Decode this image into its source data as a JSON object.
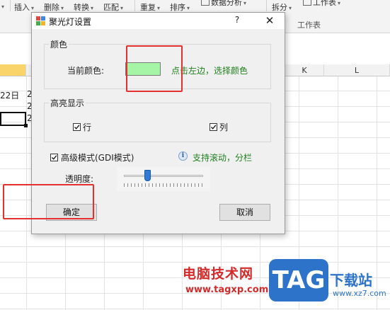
{
  "ribbon": {
    "items": [
      "插入",
      "删除",
      "转换",
      "匹配",
      "重复",
      "排序",
      "数据分析",
      "拆分",
      "工作表"
    ],
    "group_label": "工作表"
  },
  "sheet": {
    "col_k": "K",
    "col_l": "L",
    "cell_date": "22日",
    "cell_partial_1": "2",
    "cell_partial_2": "2",
    "cell_partial_3": "2"
  },
  "dialog": {
    "title": "聚光灯设置",
    "help": "?",
    "close": "✕",
    "color_group": {
      "title": "颜色",
      "current_color_label": "当前颜色:",
      "current_color": "#a6f5a6",
      "hint": "点击左边，选择颜色"
    },
    "highlight_group": {
      "title": "高亮显示",
      "row_label": "行",
      "row_checked": true,
      "col_label": "列",
      "col_checked": true
    },
    "advanced_label": "高级模式(GDI模式)",
    "advanced_checked": true,
    "advanced_hint": "支持滚动，分栏",
    "opacity_label": "透明度:",
    "opacity_fraction": 0.3,
    "ok_label": "确定",
    "cancel_label": "取消"
  },
  "watermark": {
    "site_cn": "电脑技术网",
    "site_url": "www.tagxp.com",
    "logo": "TAG",
    "xz_cn": "下载站",
    "xz_url": "www.xz7.com"
  },
  "colors": {
    "accent": "#2f7bd6",
    "annotation_red": "#e53030",
    "hint_green": "#1f7f1f",
    "highlight_col": "#f9d46a"
  }
}
